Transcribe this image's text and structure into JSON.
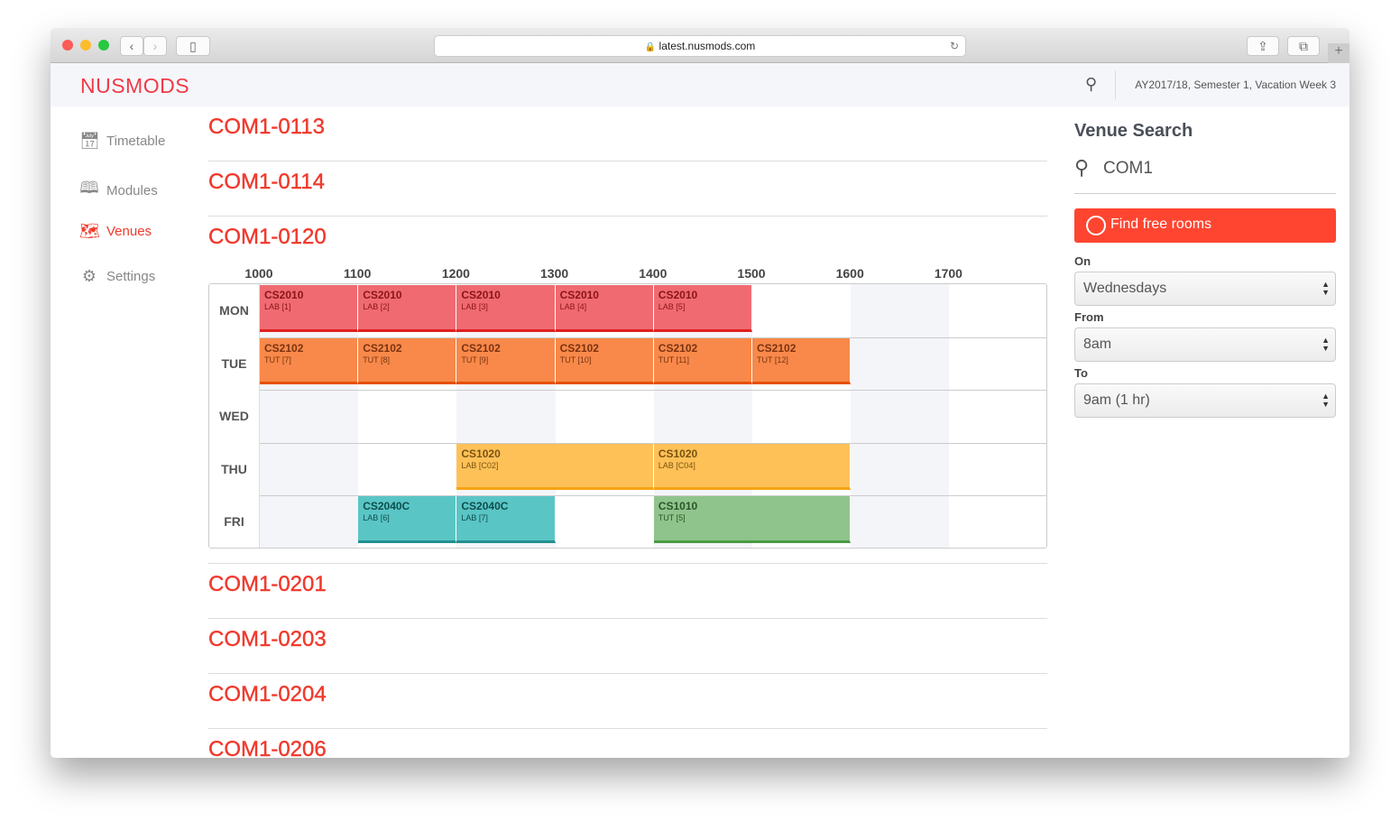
{
  "browser": {
    "url": "latest.nusmods.com"
  },
  "header": {
    "logo": "NUSMODS",
    "semester": "AY2017/18, Semester 1, Vacation Week 3"
  },
  "sidebar": {
    "items": [
      {
        "label": "Timetable",
        "icon": "calendar-icon",
        "active": false
      },
      {
        "label": "Modules",
        "icon": "book-icon",
        "active": false
      },
      {
        "label": "Venues",
        "icon": "map-icon",
        "active": true
      },
      {
        "label": "Settings",
        "icon": "gear-icon",
        "active": false
      }
    ]
  },
  "venues_before": [
    "COM1-0113",
    "COM1-0114"
  ],
  "expanded_venue": "COM1-0120",
  "venues_after": [
    "COM1-0201",
    "COM1-0203",
    "COM1-0204",
    "COM1-0206"
  ],
  "timetable": {
    "hours": [
      "1000",
      "1100",
      "1200",
      "1300",
      "1400",
      "1500",
      "1600",
      "1700"
    ],
    "days": [
      "MON",
      "TUE",
      "WED",
      "THU",
      "FRI"
    ],
    "colors": {
      "red": [
        "#f06b71",
        "#e0201f",
        "#8a1418"
      ],
      "orange": [
        "#f8894a",
        "#e65100",
        "#7a3210"
      ],
      "yellow": [
        "#fec158",
        "#f6a313",
        "#7a5210"
      ],
      "teal": [
        "#5ac5c5",
        "#23908f",
        "#0f4d4d"
      ],
      "green": [
        "#8fc48c",
        "#4a9b44",
        "#2a5527"
      ]
    },
    "events": [
      {
        "day": 0,
        "start": 1000,
        "end": 1100,
        "code": "CS2010",
        "type": "LAB [1]",
        "color": "red"
      },
      {
        "day": 0,
        "start": 1100,
        "end": 1200,
        "code": "CS2010",
        "type": "LAB [2]",
        "color": "red"
      },
      {
        "day": 0,
        "start": 1200,
        "end": 1300,
        "code": "CS2010",
        "type": "LAB [3]",
        "color": "red"
      },
      {
        "day": 0,
        "start": 1300,
        "end": 1400,
        "code": "CS2010",
        "type": "LAB [4]",
        "color": "red"
      },
      {
        "day": 0,
        "start": 1400,
        "end": 1500,
        "code": "CS2010",
        "type": "LAB [5]",
        "color": "red"
      },
      {
        "day": 1,
        "start": 1000,
        "end": 1100,
        "code": "CS2102",
        "type": "TUT [7]",
        "color": "orange"
      },
      {
        "day": 1,
        "start": 1100,
        "end": 1200,
        "code": "CS2102",
        "type": "TUT [8]",
        "color": "orange"
      },
      {
        "day": 1,
        "start": 1200,
        "end": 1300,
        "code": "CS2102",
        "type": "TUT [9]",
        "color": "orange"
      },
      {
        "day": 1,
        "start": 1300,
        "end": 1400,
        "code": "CS2102",
        "type": "TUT [10]",
        "color": "orange"
      },
      {
        "day": 1,
        "start": 1400,
        "end": 1500,
        "code": "CS2102",
        "type": "TUT [11]",
        "color": "orange"
      },
      {
        "day": 1,
        "start": 1500,
        "end": 1600,
        "code": "CS2102",
        "type": "TUT [12]",
        "color": "orange"
      },
      {
        "day": 3,
        "start": 1200,
        "end": 1400,
        "code": "CS1020",
        "type": "LAB [C02]",
        "color": "yellow"
      },
      {
        "day": 3,
        "start": 1400,
        "end": 1600,
        "code": "CS1020",
        "type": "LAB [C04]",
        "color": "yellow"
      },
      {
        "day": 4,
        "start": 1100,
        "end": 1200,
        "code": "CS2040C",
        "type": "LAB [6]",
        "color": "teal"
      },
      {
        "day": 4,
        "start": 1200,
        "end": 1300,
        "code": "CS2040C",
        "type": "LAB [7]",
        "color": "teal"
      },
      {
        "day": 4,
        "start": 1400,
        "end": 1600,
        "code": "CS1010",
        "type": "TUT [5]",
        "color": "green"
      }
    ]
  },
  "venue_search": {
    "title": "Venue Search",
    "query": "COM1",
    "find_button": "Find free rooms",
    "accent": "#ff4530",
    "on_label": "On",
    "on_value": "Wednesdays",
    "from_label": "From",
    "from_value": "8am",
    "to_label": "To",
    "to_value": "9am (1 hr)"
  }
}
